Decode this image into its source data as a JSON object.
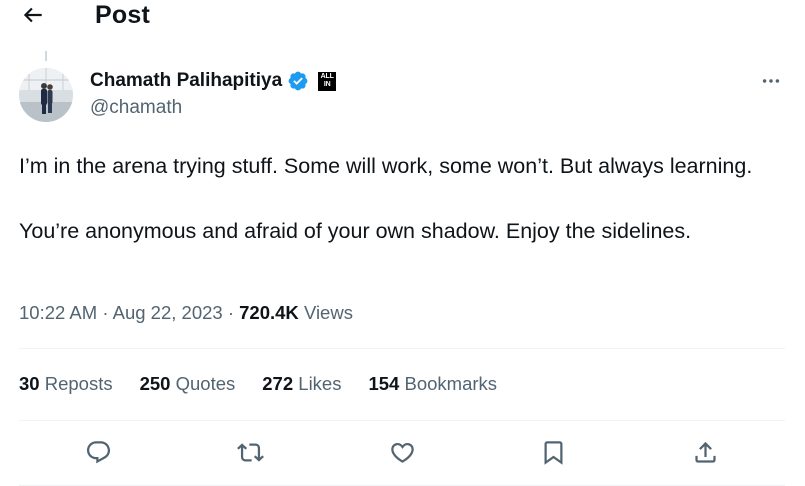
{
  "header": {
    "title": "Post"
  },
  "author": {
    "name": "Chamath Palihapitiya",
    "handle": "@chamath",
    "affiliation_logo": "ALL IN"
  },
  "tweet": {
    "paragraphs": [
      "I’m in the arena trying stuff. Some will work, some won’t. But always learning.",
      "You’re anonymous and afraid of your own shadow. Enjoy the sidelines."
    ],
    "time": "10:22 AM",
    "date": "Aug 22, 2023",
    "separator": "·",
    "views_count": "720.4K",
    "views_label": "Views"
  },
  "stats": {
    "reposts": {
      "count": "30",
      "label": "Reposts"
    },
    "quotes": {
      "count": "250",
      "label": "Quotes"
    },
    "likes": {
      "count": "272",
      "label": "Likes"
    },
    "bookmarks": {
      "count": "154",
      "label": "Bookmarks"
    }
  },
  "icons": {
    "back": "arrow-left-icon",
    "verified": "verified-badge-icon",
    "more": "more-horizontal-icon",
    "reply": "reply-icon",
    "repost": "repost-icon",
    "like": "heart-icon",
    "bookmark": "bookmark-icon",
    "share": "share-icon"
  },
  "colors": {
    "verified": "#1d9bf0",
    "text_primary": "#0f1419",
    "text_secondary": "#536471",
    "divider": "#eff3f4"
  }
}
